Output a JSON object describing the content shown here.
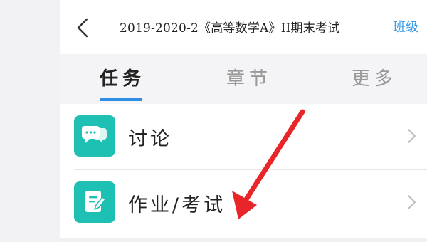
{
  "header": {
    "back_icon": "chevron-left-icon",
    "title": "2019-2020-2《高等数学A》II期末考试",
    "class_link": "班级",
    "accent_color": "#3a9be8"
  },
  "tabs": [
    {
      "label": "任务",
      "active": true
    },
    {
      "label": "章节",
      "active": false
    },
    {
      "label": "更多",
      "active": false
    }
  ],
  "list": {
    "items": [
      {
        "label": "讨论",
        "icon": "chat-bubbles-icon"
      },
      {
        "label": "作业/考试",
        "icon": "edit-document-icon"
      }
    ],
    "icon_color": "#1ec0b4"
  },
  "annotation": {
    "arrow_color": "#e8262a"
  }
}
